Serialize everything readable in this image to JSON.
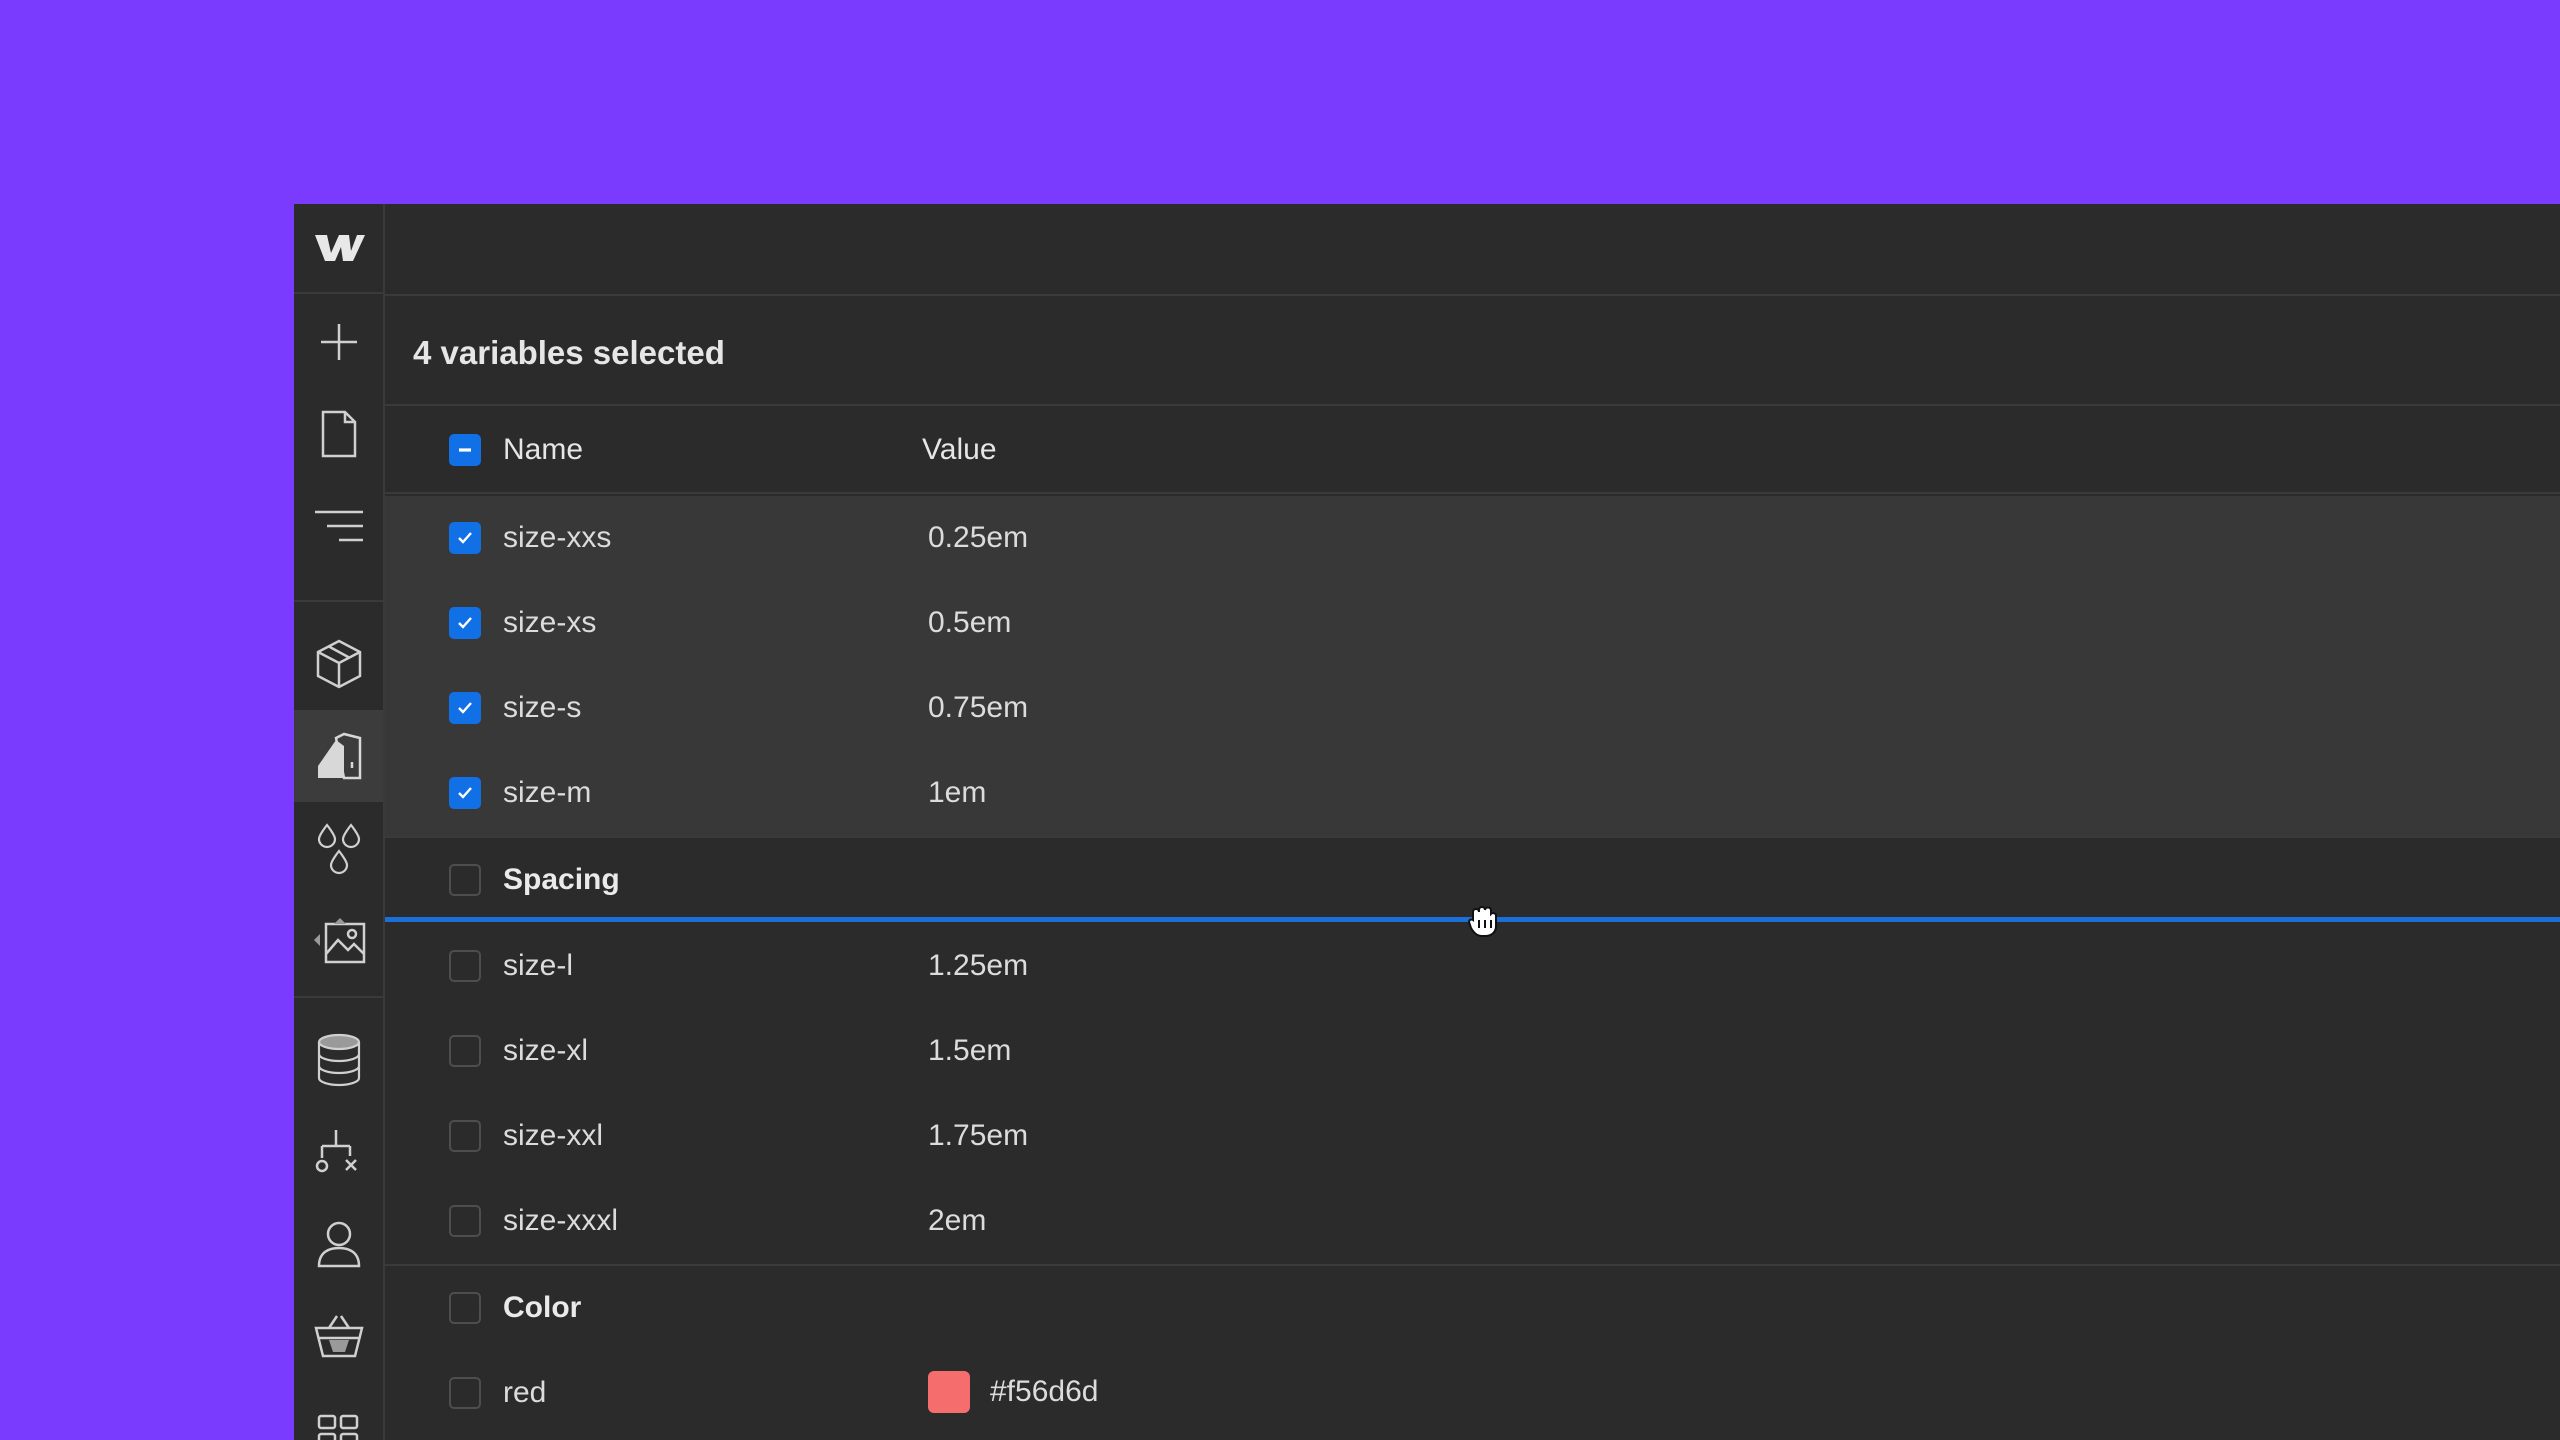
{
  "header": {
    "selection_title": "4 variables selected"
  },
  "columns": {
    "name": "Name",
    "value": "Value"
  },
  "rows_selected": [
    {
      "name": "size-xxs",
      "value": "0.25em",
      "checked": true
    },
    {
      "name": "size-xs",
      "value": "0.5em",
      "checked": true
    },
    {
      "name": "size-s",
      "value": "0.75em",
      "checked": true
    },
    {
      "name": "size-m",
      "value": "1em",
      "checked": true
    }
  ],
  "groups": {
    "spacing": {
      "label": "Spacing"
    },
    "color": {
      "label": "Color"
    }
  },
  "rows_spacing": [
    {
      "name": "size-l",
      "value": "1.25em"
    },
    {
      "name": "size-xl",
      "value": "1.5em"
    },
    {
      "name": "size-xxl",
      "value": "1.75em"
    },
    {
      "name": "size-xxxl",
      "value": "2em"
    }
  ],
  "rows_color": [
    {
      "name": "red",
      "value": "#f56d6d",
      "swatch": "#f56d6d"
    }
  ],
  "colors": {
    "background": "#7b3bff",
    "panel": "#2b2b2b",
    "accent": "#1170e6",
    "drop_indicator": "#1a6fd8"
  },
  "sidebar_icons": [
    "webflow-logo-icon",
    "add-icon",
    "page-icon",
    "navigator-icon",
    "components-icon",
    "style-guide-icon",
    "variables-icon",
    "assets-icon",
    "cms-icon",
    "logic-icon",
    "users-icon",
    "ecommerce-icon",
    "apps-icon"
  ]
}
